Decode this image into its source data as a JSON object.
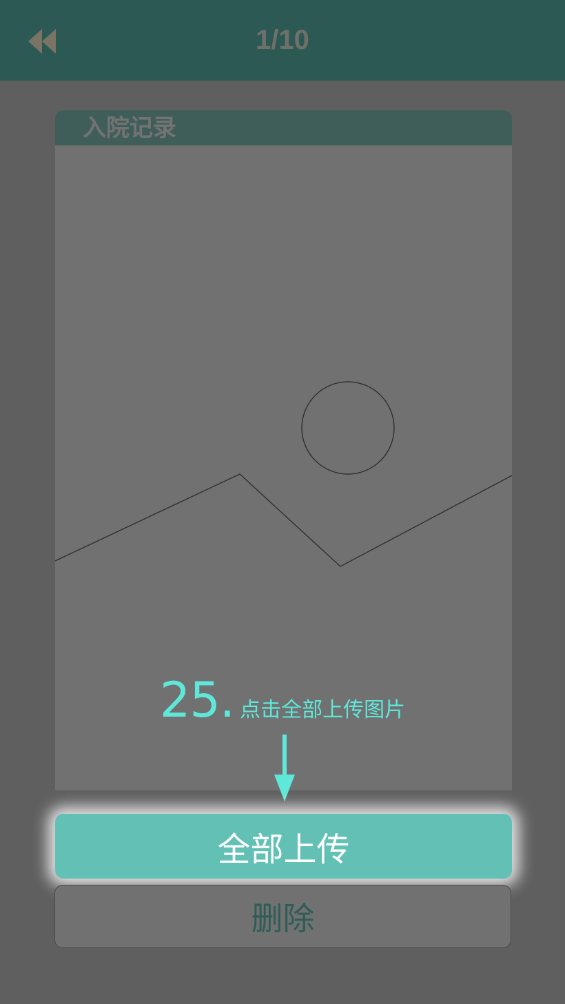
{
  "header": {
    "back_icon": "double-chevron-left-icon",
    "page_indicator": "1/10"
  },
  "panel": {
    "title": "入院记录",
    "image_placeholder_icon": "image-placeholder-icon"
  },
  "hint": {
    "step_number": "25.",
    "text": "点击全部上传图片",
    "color": "#5fe8da"
  },
  "buttons": {
    "upload_all": "全部上传",
    "delete": "删除"
  },
  "colors": {
    "header_bg": "#2c5954",
    "accent": "#62c0b5"
  }
}
